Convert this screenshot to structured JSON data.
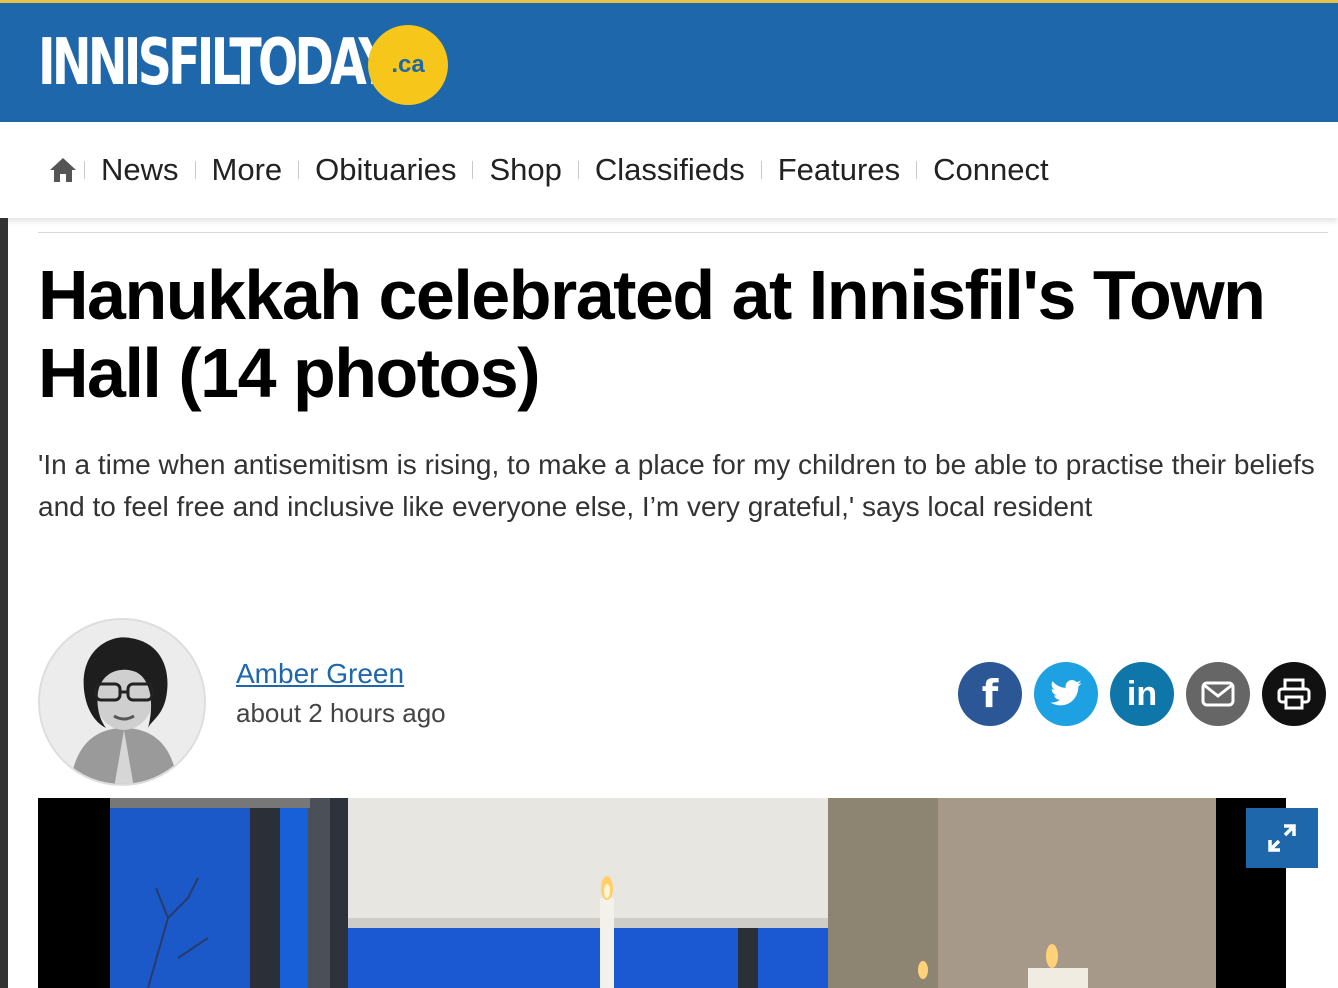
{
  "site": {
    "logo_text": "INNISFILTODAY",
    "logo_badge": ".ca",
    "colors": {
      "header_bg": "#1f67ab",
      "badge": "#f6c61b",
      "top_border": "#e5c24a"
    }
  },
  "nav": {
    "home_icon": "home-icon",
    "items": [
      {
        "label": "News"
      },
      {
        "label": "More"
      },
      {
        "label": "Obituaries"
      },
      {
        "label": "Shop"
      },
      {
        "label": "Classifieds"
      },
      {
        "label": "Features"
      },
      {
        "label": "Connect"
      }
    ]
  },
  "article": {
    "title": "Hanukkah celebrated at Innisfil's Town Hall (14 photos)",
    "subtitle": "'In a time when antisemitism is rising, to make a place for my children to be able to practise their beliefs and to feel free and inclusive like everyone else, I’m very grateful,' says local resident",
    "author": "Amber Green",
    "time": "about 2 hours ago"
  },
  "share": [
    {
      "name": "facebook",
      "glyph": "f",
      "color": "#2b5797",
      "icon": "facebook-icon"
    },
    {
      "name": "twitter",
      "glyph": "",
      "color": "#1da1e2",
      "icon": "twitter-icon"
    },
    {
      "name": "linkedin",
      "glyph": "in",
      "color": "#0e76a8",
      "icon": "linkedin-icon"
    },
    {
      "name": "email",
      "glyph": "",
      "color": "#666666",
      "icon": "email-icon"
    },
    {
      "name": "print",
      "glyph": "",
      "color": "#111111",
      "icon": "print-icon"
    }
  ]
}
